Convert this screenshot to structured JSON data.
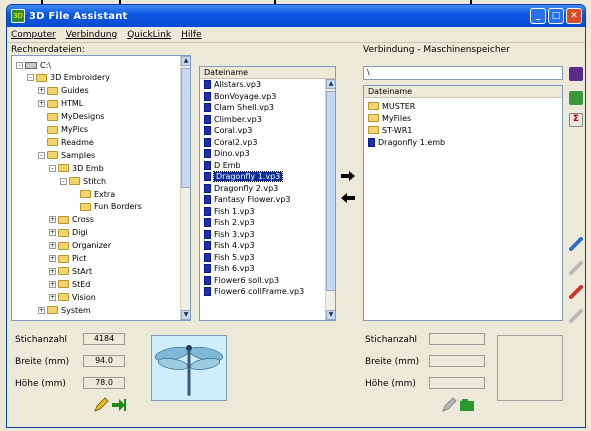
{
  "window": {
    "title": "3D File Assistant"
  },
  "title_buttons": [
    "_",
    "□",
    "✕"
  ],
  "menu": [
    "Computer",
    "Verbindung",
    "QuickLink",
    "Hilfe"
  ],
  "left_label": "Rechnerdateien:",
  "right_label": "Verbindung - Maschinenspeicher",
  "tree": [
    {
      "label": "C:\\",
      "icon": "drive",
      "exp": "-",
      "indent": 0
    },
    {
      "label": "3D Embroidery",
      "icon": "folder",
      "exp": "-",
      "indent": 1
    },
    {
      "label": "Guides",
      "icon": "folder",
      "exp": "+",
      "indent": 2
    },
    {
      "label": "HTML",
      "icon": "folder",
      "exp": "+",
      "indent": 2
    },
    {
      "label": "MyDesigns",
      "icon": "folder",
      "exp": "",
      "indent": 2
    },
    {
      "label": "MyPics",
      "icon": "folder",
      "exp": "",
      "indent": 2
    },
    {
      "label": "Readme",
      "icon": "folder",
      "exp": "",
      "indent": 2
    },
    {
      "label": "Samples",
      "icon": "folder",
      "exp": "-",
      "indent": 2
    },
    {
      "label": "3D Emb",
      "icon": "folder",
      "exp": "-",
      "indent": 3
    },
    {
      "label": "Stitch",
      "icon": "folder",
      "exp": "-",
      "indent": 4
    },
    {
      "label": "Extra",
      "icon": "folder",
      "exp": "",
      "indent": 5
    },
    {
      "label": "Fun Borders",
      "icon": "folder",
      "exp": "",
      "indent": 5
    },
    {
      "label": "Cross",
      "icon": "folder",
      "exp": "+",
      "indent": 3
    },
    {
      "label": "Digi",
      "icon": "folder",
      "exp": "+",
      "indent": 3
    },
    {
      "label": "Organizer",
      "icon": "folder",
      "exp": "+",
      "indent": 3
    },
    {
      "label": "Pict",
      "icon": "folder",
      "exp": "+",
      "indent": 3
    },
    {
      "label": "StArt",
      "icon": "folder",
      "exp": "+",
      "indent": 3
    },
    {
      "label": "StEd",
      "icon": "folder",
      "exp": "+",
      "indent": 3
    },
    {
      "label": "Vision",
      "icon": "folder",
      "exp": "+",
      "indent": 3
    },
    {
      "label": "System",
      "icon": "folder",
      "exp": "+",
      "indent": 2
    }
  ],
  "files_header": "Dateiname",
  "files": [
    "Allstars.vp3",
    "BonVoyage.vp3",
    "Clam Shell.vp3",
    "Climber.vp3",
    "Coral.vp3",
    "Coral2.vp3",
    "Dino.vp3",
    "D Emb",
    "Dragonfly 1.vp3",
    "Dragonfly 2.vp3",
    "Fantasy Flower.vp3",
    "Fish 1.vp3",
    "Fish 2.vp3",
    "Fish 3.vp3",
    "Fish 4.vp3",
    "Fish 5.vp3",
    "Fish 6.vp3",
    "Flower6 soll.vp3",
    "Flower6 collFrame.vp3"
  ],
  "selected_file_index": 8,
  "machine_path": "\\",
  "machine_header": "Dateiname",
  "machine_items": [
    {
      "label": "MUSTER",
      "icon": "folder"
    },
    {
      "label": "MyFiles",
      "icon": "folder"
    },
    {
      "label": "ST-WR1",
      "icon": "folder"
    },
    {
      "label": "Dragonfly 1.emb",
      "icon": "file"
    }
  ],
  "left_stats": {
    "stitches_label": "Stichanzahl",
    "stitches_value": "4184",
    "width_label": "Breite (mm)",
    "width_value": "94.0",
    "height_label": "Höhe (mm)",
    "height_value": "78.0"
  },
  "right_stats": {
    "stitches_label": "Stichanzahl",
    "width_label": "Breite (mm)",
    "height_label": "Höhe (mm)"
  },
  "colors": {
    "titlebar": "#0a54e2",
    "selection": "#0a2c9c",
    "file_icon": "#1c2fb8"
  }
}
